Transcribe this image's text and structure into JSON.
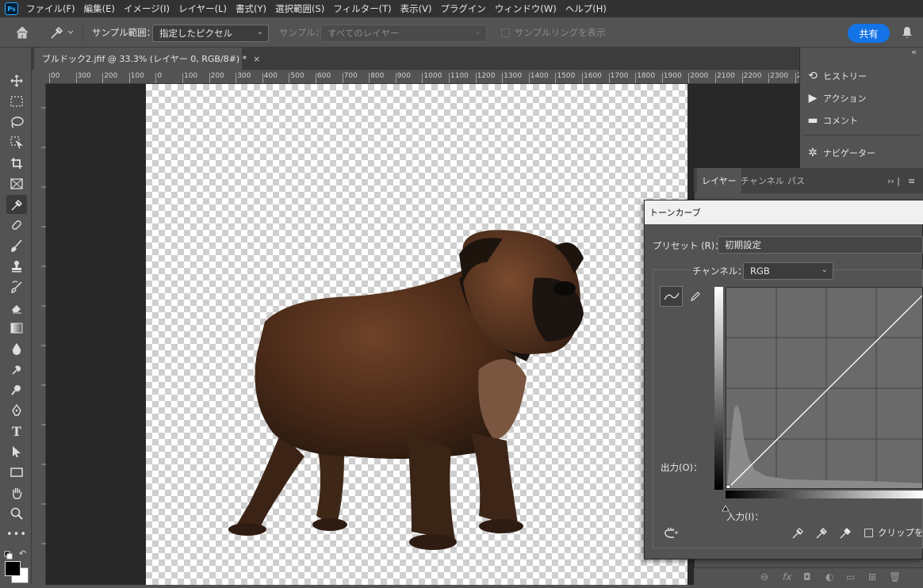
{
  "app": {
    "logo": "Ps"
  },
  "menu": [
    "ファイル(F)",
    "編集(E)",
    "イメージ(I)",
    "レイヤー(L)",
    "書式(Y)",
    "選択範囲(S)",
    "フィルター(T)",
    "表示(V)",
    "プラグイン",
    "ウィンドウ(W)",
    "ヘルプ(H)"
  ],
  "options": {
    "sample_range_label": "サンプル範囲：",
    "sample_range_value": "指定したピクセル",
    "sample_label": "サンプル：",
    "sample_value": "すべてのレイヤー",
    "sample_ring_label": "サンプルリングを表示",
    "share_label": "共有"
  },
  "document": {
    "tab_title": "ブルドック2.jfif @ 33.3% (レイヤー 0, RGB/8#) *",
    "close": "×"
  },
  "ruler": {
    "h_ticks": [
      "00",
      "300",
      "200",
      "100",
      "0",
      "100",
      "200",
      "300",
      "400",
      "500",
      "600",
      "700",
      "800",
      "900",
      "1000",
      "1100",
      "1200",
      "1300",
      "1400",
      "1500",
      "1600",
      "1700",
      "1800",
      "1900",
      "2000",
      "2100",
      "2200",
      "2300",
      "2"
    ]
  },
  "panels": {
    "collapse_left": "»",
    "collapse_right": "«",
    "history": "ヒストリー",
    "actions": "アクション",
    "comments": "コメント",
    "navigator": "ナビゲーター",
    "tabs": [
      "レイヤー",
      "チャンネル",
      "パス"
    ]
  },
  "curves": {
    "title": "トーンカーブ",
    "preset_label": "プリセット (R)：",
    "preset_value": "初期設定",
    "channel_label": "チャンネル：",
    "channel_value": "RGB",
    "output_label": "出力(O)：",
    "input_label": "入力(I)：",
    "clipping_label": "クリップを表"
  },
  "icons": {
    "tools": [
      "move-icon",
      "marquee-icon",
      "lasso-icon",
      "object-select-icon",
      "crop-icon",
      "frame-icon",
      "eyedropper-icon",
      "healing-icon",
      "brush-icon",
      "stamp-icon",
      "history-brush-icon",
      "eraser-icon",
      "gradient-icon",
      "blur-icon",
      "dodge-icon",
      "burn-icon",
      "pen-icon",
      "type-icon",
      "path-select-icon",
      "rectangle-icon",
      "hand-icon",
      "zoom-icon",
      "more-icon"
    ]
  },
  "colors": {
    "accent": "#1473e6",
    "panel": "#535353",
    "menubar": "#323232"
  }
}
